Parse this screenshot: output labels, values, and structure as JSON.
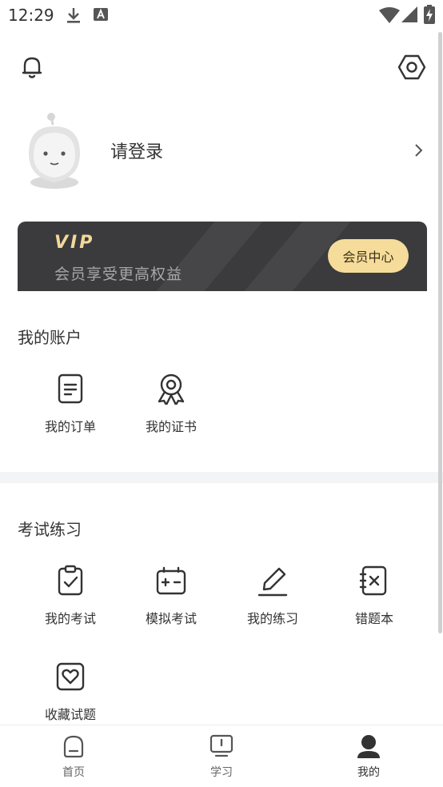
{
  "status_bar": {
    "time": "12:29",
    "left_icons": [
      "download-icon",
      "keyboard-a-icon"
    ],
    "right_icons": [
      "wifi-icon",
      "signal-icon",
      "battery-charging-icon"
    ]
  },
  "header": {
    "notification_icon": "bell-icon",
    "settings_icon": "hexagon-settings-icon"
  },
  "profile": {
    "login_text": "请登录",
    "avatar_icon": "robot-avatar-icon"
  },
  "vip": {
    "title": "VIP",
    "subtitle": "会员享受更高权益",
    "button_label": "会员中心",
    "colors": {
      "card": "#3b3b3d",
      "accent": "#f3d89a",
      "button": "#f6dc9a"
    }
  },
  "account": {
    "title": "我的账户",
    "items": [
      {
        "label": "我的订单",
        "icon": "order-document-icon"
      },
      {
        "label": "我的证书",
        "icon": "certificate-badge-icon"
      }
    ]
  },
  "exam": {
    "title": "考试练习",
    "items": [
      {
        "label": "我的考试",
        "icon": "clipboard-check-icon"
      },
      {
        "label": "模拟考试",
        "icon": "battery-plus-minus-icon"
      },
      {
        "label": "我的练习",
        "icon": "pencil-icon"
      },
      {
        "label": "错题本",
        "icon": "wrong-notebook-icon"
      },
      {
        "label": "收藏试题",
        "icon": "heart-frame-icon"
      }
    ]
  },
  "bottom_nav": {
    "items": [
      {
        "label": "首页",
        "icon": "home-icon",
        "active": false
      },
      {
        "label": "学习",
        "icon": "study-icon",
        "active": false
      },
      {
        "label": "我的",
        "icon": "user-icon",
        "active": true
      }
    ]
  }
}
